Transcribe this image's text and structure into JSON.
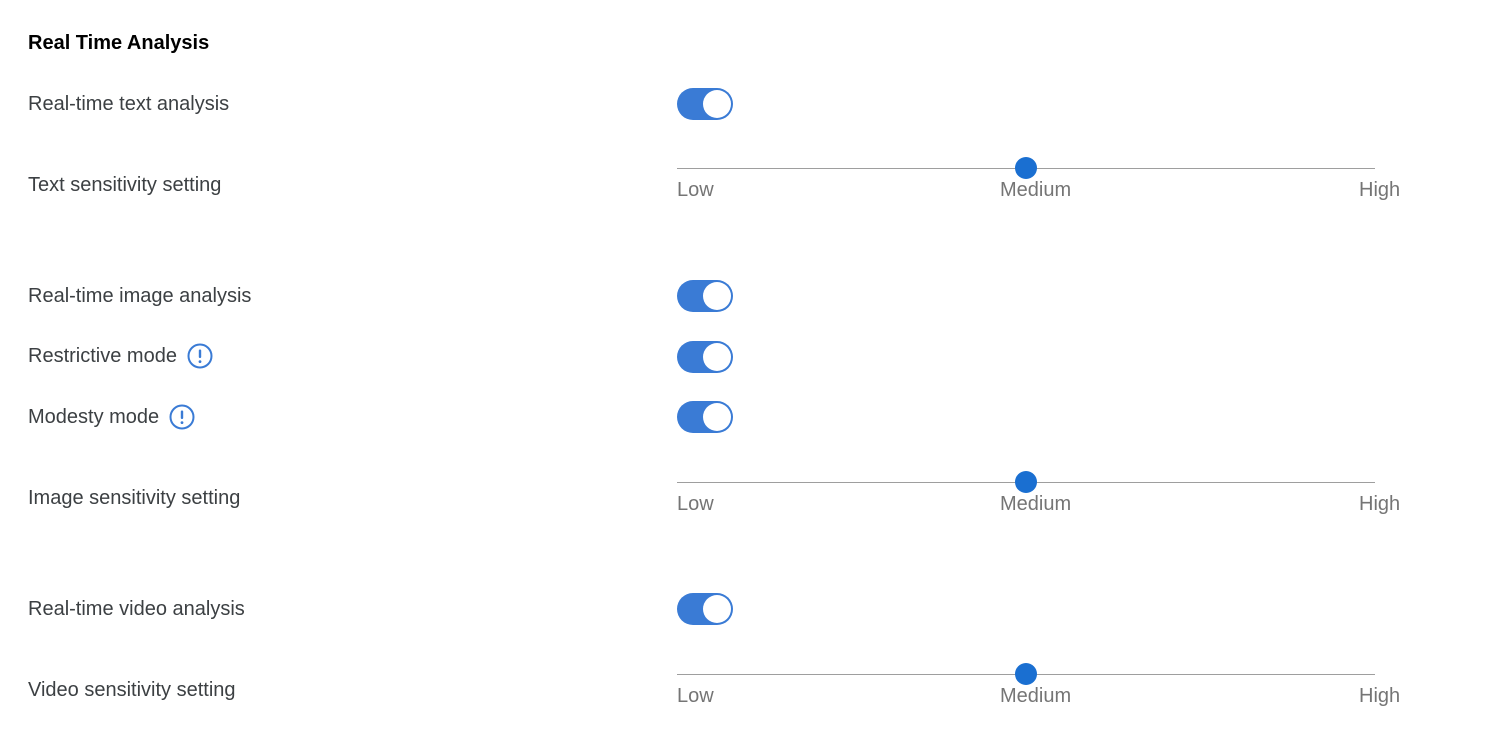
{
  "section": {
    "title": "Real Time Analysis"
  },
  "colors": {
    "toggle_on": "#3a7bd5",
    "slider_thumb": "#1a6fd1",
    "info_icon": "#3a7bd5"
  },
  "rows": {
    "text_analysis": {
      "label": "Real-time text analysis",
      "enabled": true
    },
    "text_sensitivity": {
      "label": "Text sensitivity setting",
      "value": "Medium",
      "level": 0.5,
      "ticks": [
        "Low",
        "Medium",
        "High"
      ]
    },
    "image_analysis": {
      "label": "Real-time image analysis",
      "enabled": true
    },
    "restrictive_mode": {
      "label": "Restrictive mode",
      "enabled": true,
      "icon": "info-icon"
    },
    "modesty_mode": {
      "label": "Modesty mode",
      "enabled": true,
      "icon": "info-icon"
    },
    "image_sensitivity": {
      "label": "Image sensitivity setting",
      "value": "Medium",
      "level": 0.5,
      "ticks": [
        "Low",
        "Medium",
        "High"
      ]
    },
    "video_analysis": {
      "label": "Real-time video analysis",
      "enabled": true
    },
    "video_sensitivity": {
      "label": "Video sensitivity setting",
      "value": "Medium",
      "level": 0.5,
      "ticks": [
        "Low",
        "Medium",
        "High"
      ]
    }
  }
}
